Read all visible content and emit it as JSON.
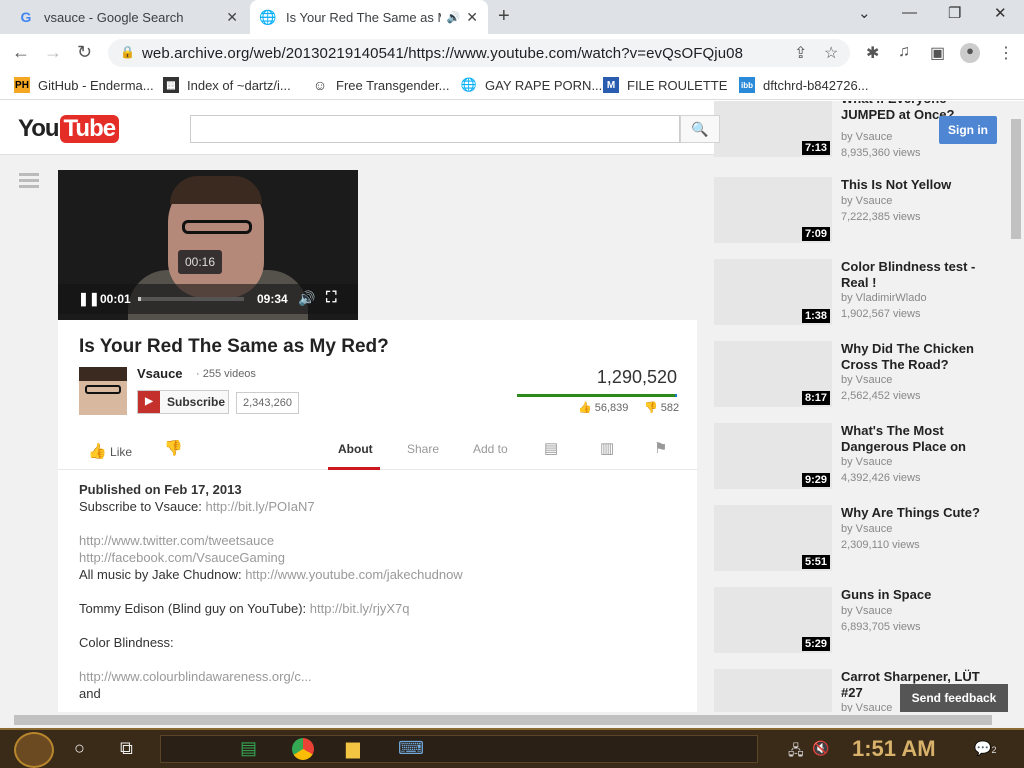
{
  "browser": {
    "tabs": [
      {
        "favicon": "G",
        "title": "vsauce - Google Search",
        "close": "✕"
      },
      {
        "favicon": "🌐",
        "title": "Is Your Red The Same as M",
        "audio_icon": "🔊",
        "close": "✕"
      }
    ],
    "new_tab": "+",
    "window_controls": {
      "minimize": "—",
      "restore": "❐",
      "close": "✕",
      "dropdown": "⌄"
    },
    "url": "web.archive.org/web/20130219140541/https://www.youtube.com/watch?v=evQsOFQju08",
    "bookmarks": [
      {
        "icon": "PH",
        "label": "GitHub - Enderma...",
        "color": "#f5a623"
      },
      {
        "icon": "▦",
        "label": "Index of ~dartz/i...",
        "color": "#333333"
      },
      {
        "icon": "☺",
        "label": "Free Transgender...",
        "color": "#555555"
      },
      {
        "icon": "🌐",
        "label": "GAY RAPE PORN...",
        "color": "#555555"
      },
      {
        "icon": "M",
        "label": "FILE ROULETTE",
        "color": "#2a5db0"
      },
      {
        "icon": "ibb",
        "label": "dftchrd-b842726...",
        "color": "#2a8ad8"
      }
    ]
  },
  "youtube": {
    "logo_you": "You",
    "logo_tube": "Tube",
    "search_icon": "🔍",
    "signin": "Sign in"
  },
  "player": {
    "tooltip_time": "00:16",
    "current_time": "00:01",
    "duration": "09:34",
    "progress_fraction": 0.03
  },
  "video": {
    "title": "Is Your Red The Same as My Red?",
    "channel": "Vsauce",
    "video_count": "· 255 videos",
    "subscribe": "Subscribe",
    "subscriber_count": "2,343,260",
    "views": "1,290,520",
    "likes": "56,839",
    "dislikes": "582",
    "like_fraction": 0.99
  },
  "actions": {
    "like": "Like",
    "about": "About",
    "share": "Share",
    "add_to": "Add to"
  },
  "description": {
    "published": "Published on Feb 17, 2013",
    "subscribe_text": "Subscribe to Vsauce: ",
    "subscribe_link": "http://bit.ly/POIaN7",
    "twitter": "http://www.twitter.com/tweetsauce",
    "facebook": "http://facebook.com/VsauceGaming",
    "music_text": "All music by Jake Chudnow: ",
    "music_link": "http://www.youtube.com/jakechudnow",
    "edison_text": "Tommy Edison (Blind guy on YouTube): ",
    "edison_link": "http://bit.ly/rjyX7q",
    "color_blindness": "Color Blindness:",
    "cb_link": "http://www.colourblindawareness.org/c...",
    "and": "and"
  },
  "related": [
    {
      "title": "What if Everyone JUMPED at Once?",
      "by": "by Vsauce",
      "views": "8,935,360 views",
      "duration": "7:13"
    },
    {
      "title": "This Is Not Yellow",
      "by": "by Vsauce",
      "views": "7,222,385 views",
      "duration": "7:09"
    },
    {
      "title": "Color Blindness test - Real !",
      "by": "by VladimirWlado",
      "views": "1,902,567 views",
      "duration": "1:38"
    },
    {
      "title": "Why Did The Chicken Cross The Road?",
      "by": "by Vsauce",
      "views": "2,562,452 views",
      "duration": "8:17"
    },
    {
      "title": "What's The Most Dangerous Place on",
      "by": "by Vsauce",
      "views": "4,392,426 views",
      "duration": "9:29"
    },
    {
      "title": "Why Are Things Cute?",
      "by": "by Vsauce",
      "views": "2,309,110 views",
      "duration": "5:51"
    },
    {
      "title": "Guns in Space",
      "by": "by Vsauce",
      "views": "6,893,705 views",
      "duration": "5:29"
    },
    {
      "title": "Carrot Sharpener, LÜT #27",
      "by": "by Vsauce",
      "views": "",
      "duration": ""
    }
  ],
  "feedback": "Send feedback",
  "taskbar": {
    "clock": "1:51 AM",
    "notification_count": "2"
  }
}
